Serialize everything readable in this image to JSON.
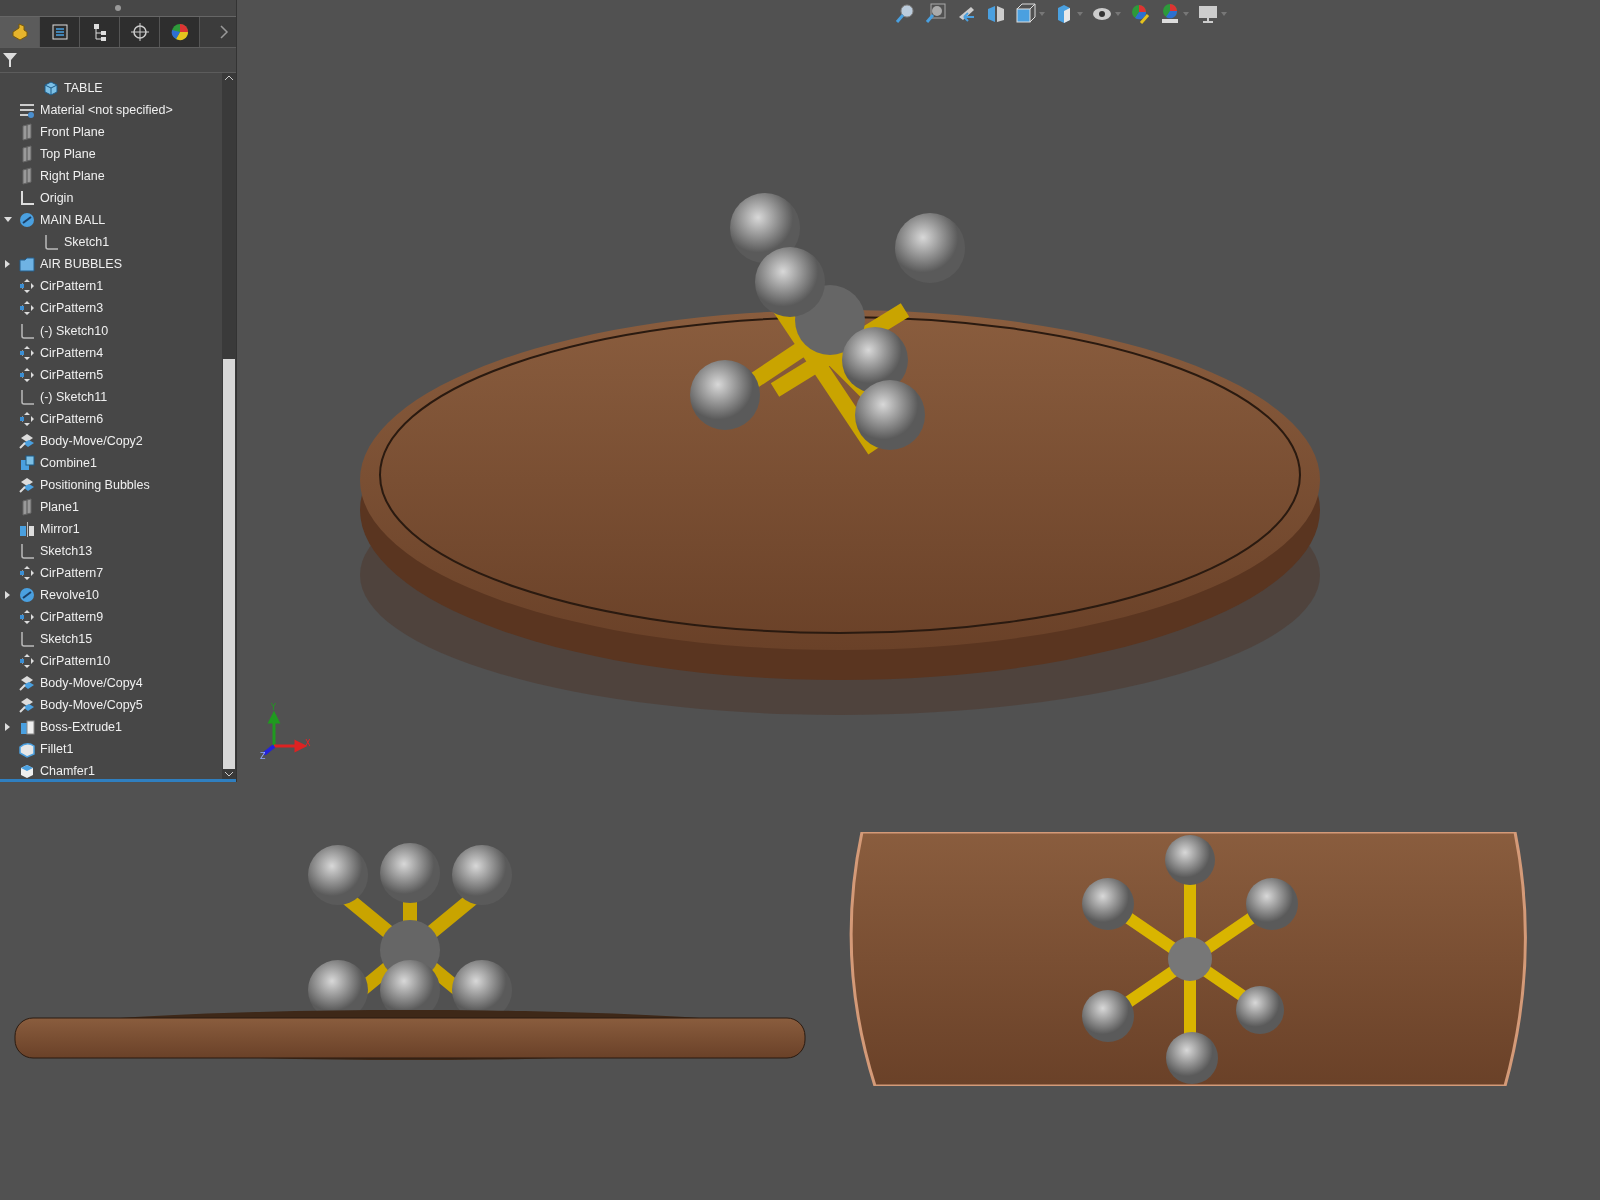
{
  "panel_tabs": [
    {
      "kind": "part",
      "selected": true
    },
    {
      "kind": "property",
      "selected": false
    },
    {
      "kind": "config",
      "selected": false
    },
    {
      "kind": "dimxpert",
      "selected": false
    },
    {
      "kind": "display",
      "selected": false
    }
  ],
  "feature_tree": [
    {
      "label": "TABLE",
      "kind": "part"
    },
    {
      "label": "Material <not specified>",
      "kind": "material"
    },
    {
      "label": "Front Plane",
      "kind": "plane"
    },
    {
      "label": "Top Plane",
      "kind": "plane"
    },
    {
      "label": "Right Plane",
      "kind": "plane"
    },
    {
      "label": "Origin",
      "kind": "origin"
    },
    {
      "label": "MAIN BALL",
      "kind": "revolve",
      "expanded": true,
      "children": [
        {
          "label": "Sketch1",
          "kind": "sketch"
        }
      ]
    },
    {
      "label": "AIR BUBBLES",
      "kind": "folder",
      "expanded": false
    },
    {
      "label": "CirPattern1",
      "kind": "pattern"
    },
    {
      "label": "CirPattern3",
      "kind": "pattern"
    },
    {
      "label": "(-) Sketch10",
      "kind": "sketch"
    },
    {
      "label": "CirPattern4",
      "kind": "pattern"
    },
    {
      "label": "CirPattern5",
      "kind": "pattern"
    },
    {
      "label": "(-) Sketch11",
      "kind": "sketch"
    },
    {
      "label": "CirPattern6",
      "kind": "pattern"
    },
    {
      "label": "Body-Move/Copy2",
      "kind": "move"
    },
    {
      "label": "Combine1",
      "kind": "combine"
    },
    {
      "label": "Positioning Bubbles",
      "kind": "move"
    },
    {
      "label": "Plane1",
      "kind": "plane"
    },
    {
      "label": "Mirror1",
      "kind": "mirror"
    },
    {
      "label": "Sketch13",
      "kind": "sketch"
    },
    {
      "label": "CirPattern7",
      "kind": "pattern"
    },
    {
      "label": "Revolve10",
      "kind": "revolve",
      "expanded": false
    },
    {
      "label": "CirPattern9",
      "kind": "pattern"
    },
    {
      "label": "Sketch15",
      "kind": "sketch"
    },
    {
      "label": "CirPattern10",
      "kind": "pattern"
    },
    {
      "label": "Body-Move/Copy4",
      "kind": "move"
    },
    {
      "label": "Body-Move/Copy5",
      "kind": "move"
    },
    {
      "label": "Boss-Extrude1",
      "kind": "extrude",
      "expanded": false
    },
    {
      "label": "Fillet1",
      "kind": "fillet"
    },
    {
      "label": "Chamfer1",
      "kind": "chamfer"
    }
  ],
  "view_toolbar": [
    {
      "kind": "zoom-fit",
      "dropdown": false
    },
    {
      "kind": "zoom-area",
      "dropdown": false
    },
    {
      "kind": "previous",
      "dropdown": false
    },
    {
      "kind": "section",
      "dropdown": false
    },
    {
      "kind": "orientation",
      "dropdown": true
    },
    {
      "kind": "display-style",
      "dropdown": true
    },
    {
      "kind": "hide-show",
      "dropdown": true
    },
    {
      "kind": "appearance",
      "dropdown": false
    },
    {
      "kind": "scene",
      "dropdown": true
    },
    {
      "kind": "view-settings",
      "dropdown": true
    }
  ],
  "triad": {
    "x": "X",
    "y": "Y",
    "z": "Z"
  },
  "views": [
    {
      "kind": "isometric"
    },
    {
      "kind": "front"
    },
    {
      "kind": "top"
    }
  ]
}
